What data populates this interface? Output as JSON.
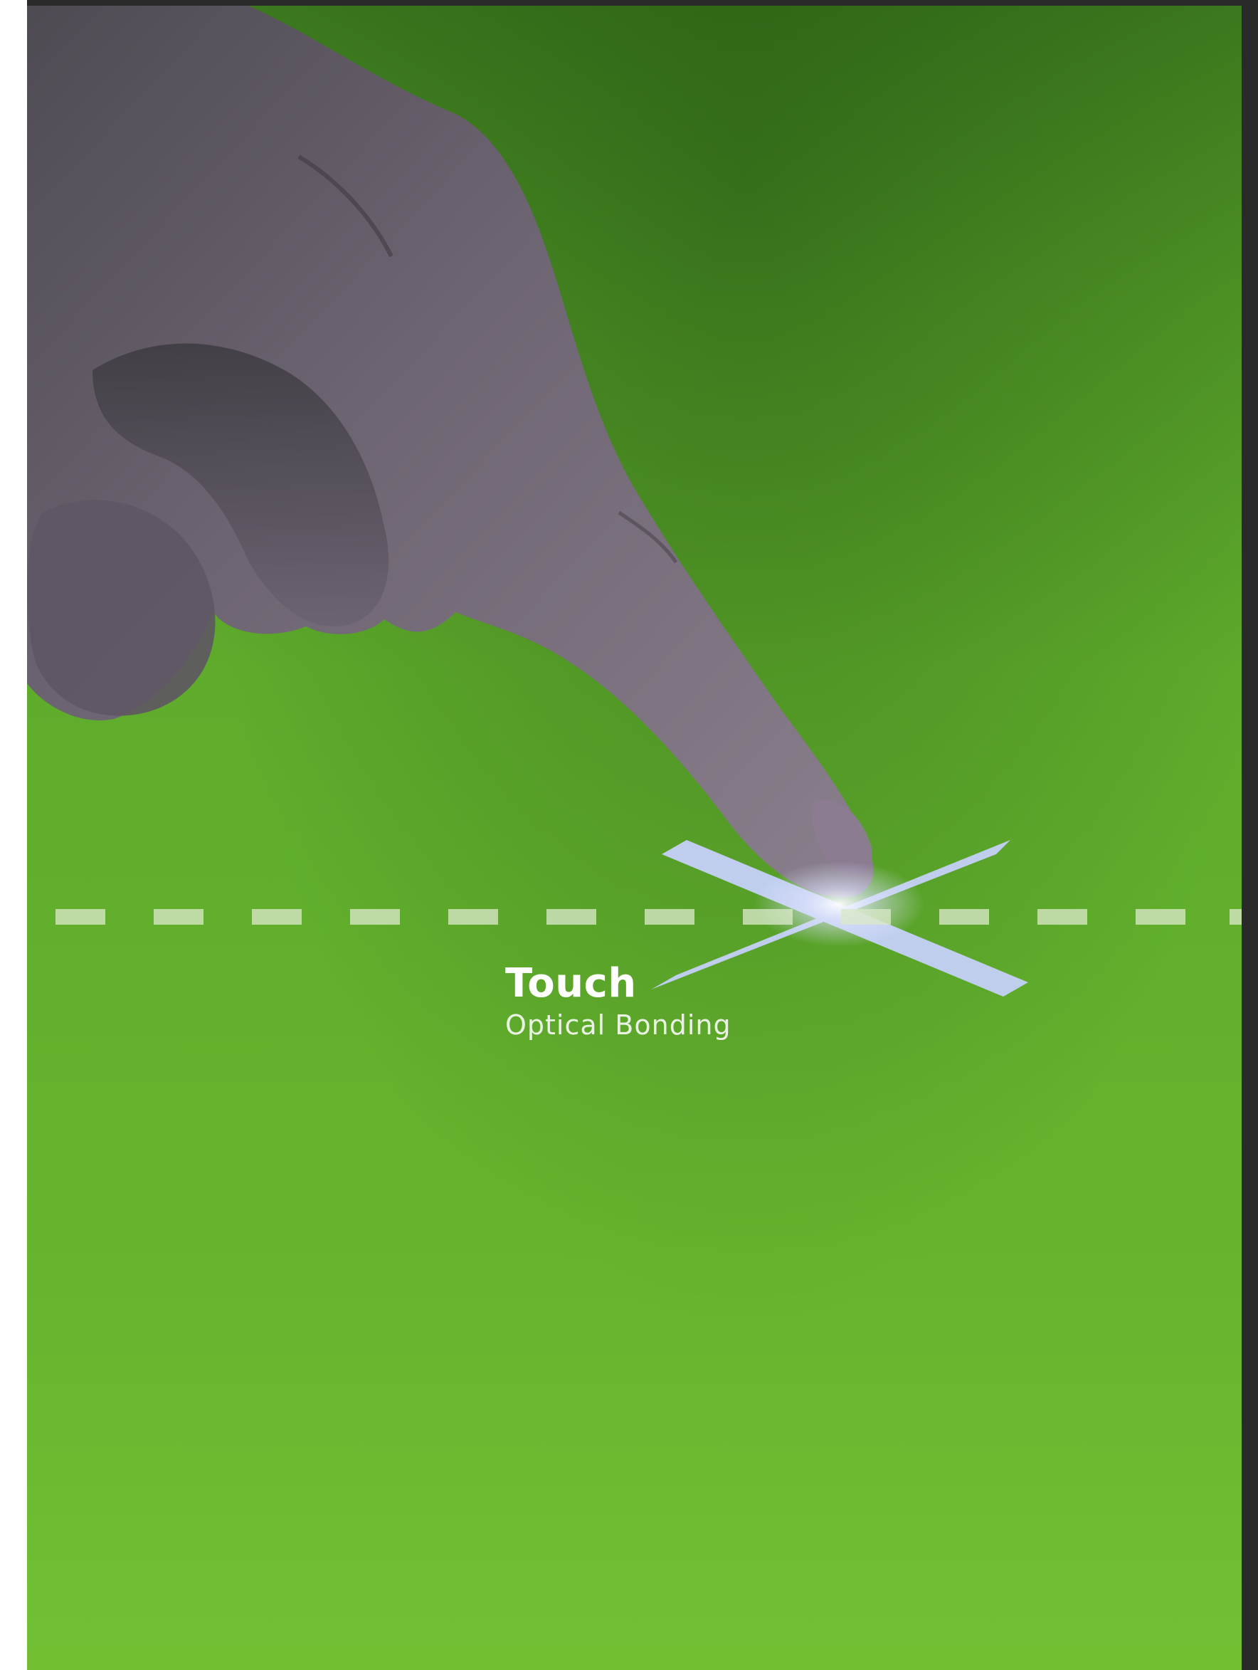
{
  "cover": {
    "title": "Touch",
    "subtitle": "Optical Bonding"
  },
  "colors": {
    "background_top": "#3d7a1e",
    "background_bottom": "#72c032",
    "accent_mark": "#c9d2ff",
    "dash": "#d9e8c8",
    "text": "#ffffff"
  },
  "icons": {
    "touch_marker": "cross-touch-point-icon"
  }
}
